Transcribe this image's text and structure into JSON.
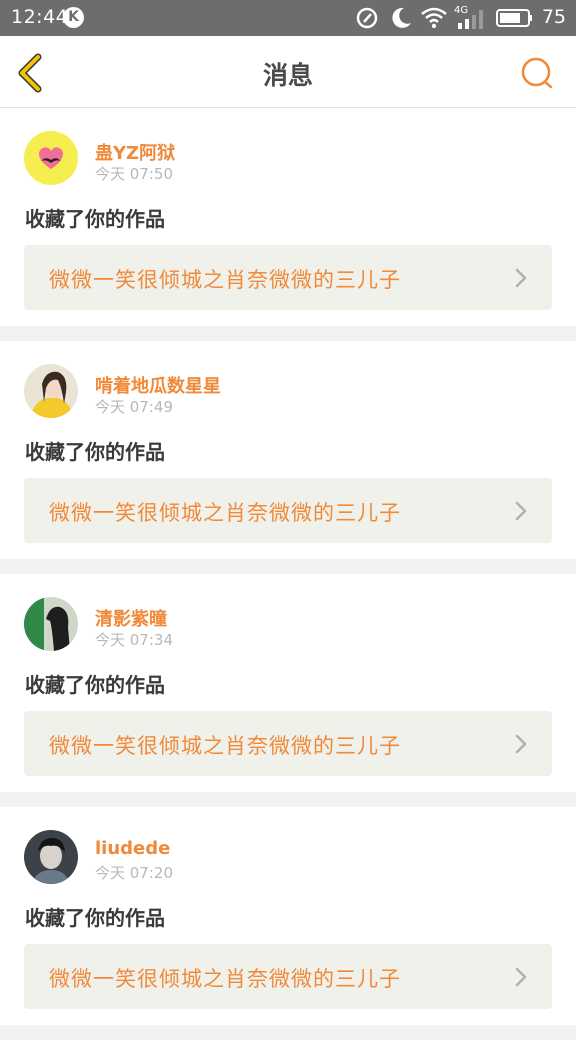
{
  "status_bar": {
    "time": "12:44",
    "k_badge": "K",
    "network": "4G",
    "battery": "75",
    "icons": [
      "k-app-icon",
      "nfc-icon",
      "do-not-disturb-icon",
      "wifi-icon",
      "signal-icon",
      "battery-icon"
    ]
  },
  "header": {
    "title": "消息",
    "back_icon": "back-chevron-icon",
    "search_icon": "search-icon"
  },
  "colors": {
    "accent": "#f08a3a",
    "back_arrow": "#f5c400",
    "work_box_bg": "#f1f1eb"
  },
  "messages": [
    {
      "username": "蛊YZ阿狱",
      "time": "今天 07:50",
      "action": "收藏了你的作品",
      "work_title": "微微一笑很倾城之肖奈微微的三儿子",
      "avatar": "heart-mustache-avatar"
    },
    {
      "username": "啃着地瓜数星星",
      "time": "今天 07:49",
      "action": "收藏了你的作品",
      "work_title": "微微一笑很倾城之肖奈微微的三儿子",
      "avatar": "girl-yellow-avatar"
    },
    {
      "username": "清影紫曈",
      "time": "今天 07:34",
      "action": "收藏了你的作品",
      "work_title": "微微一笑很倾城之肖奈微微的三儿子",
      "avatar": "girl-green-avatar"
    },
    {
      "username": "liudede",
      "time": "今天 07:20",
      "action": "收藏了你的作品",
      "work_title": "微微一笑很倾城之肖奈微微的三儿子",
      "avatar": "boy-dark-avatar"
    }
  ]
}
